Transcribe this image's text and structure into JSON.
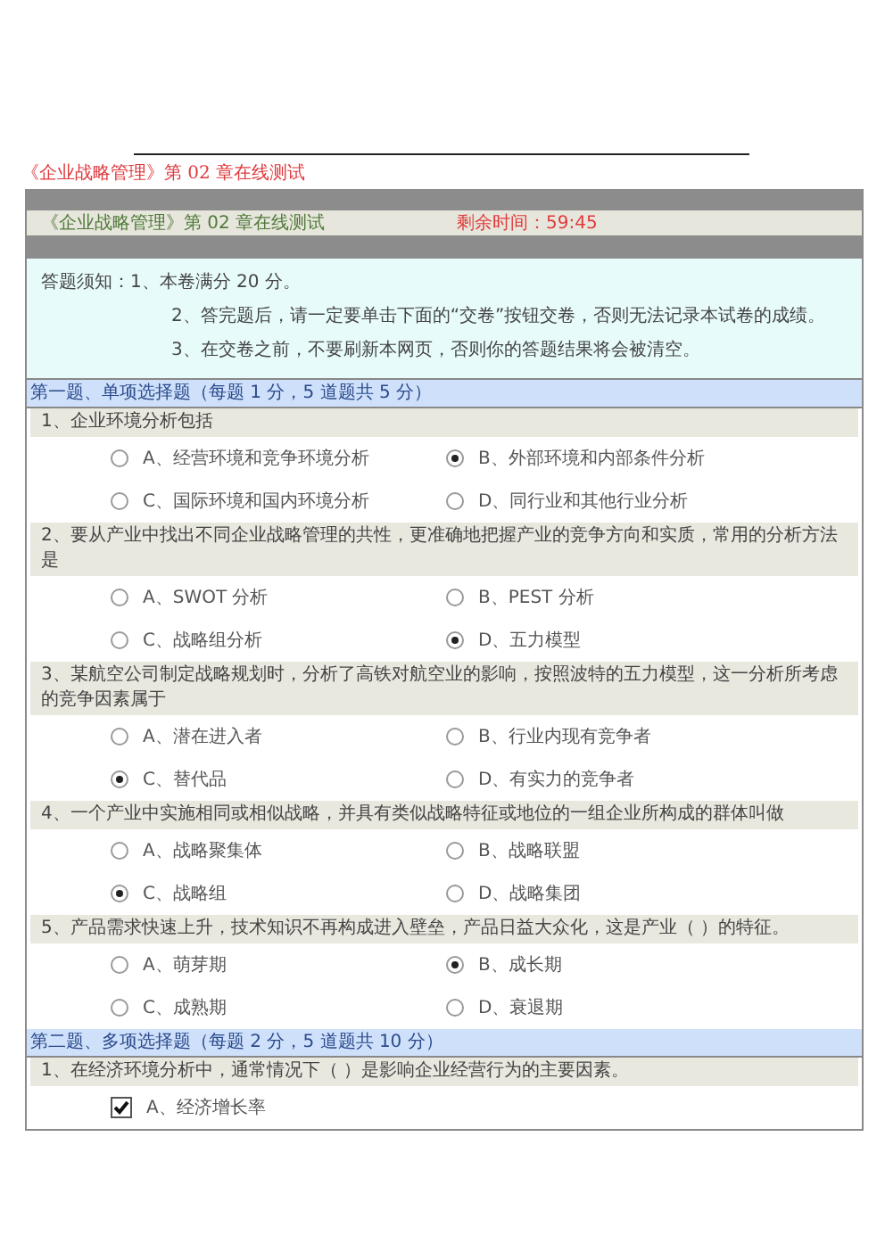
{
  "page_title": "《企业战略管理》第 02 章在线测试",
  "exam": {
    "title": "《企业战略管理》第 02 章在线测试",
    "timer": "剩余时间：59:45"
  },
  "notice": {
    "label": "答题须知：",
    "lines": [
      "1、本卷满分 20 分。",
      "2、答完题后，请一定要单击下面的“交卷”按钮交卷，否则无法记录本试卷的成绩。",
      "3、在交卷之前，不要刷新本网页，否则你的答题结果将会被清空。"
    ]
  },
  "sections": [
    {
      "title": "第一题、单项选择题（每题 1 分，5 道题共 5 分）",
      "kind": "single",
      "questions": [
        {
          "text": "1、企业环境分析包括",
          "options": [
            {
              "label": "A、经营环境和竞争环境分析",
              "selected": false
            },
            {
              "label": "B、外部环境和内部条件分析",
              "selected": true
            },
            {
              "label": "C、国际环境和国内环境分析",
              "selected": false
            },
            {
              "label": "D、同行业和其他行业分析",
              "selected": false
            }
          ]
        },
        {
          "text": "2、要从产业中找出不同企业战略管理的共性，更准确地把握产业的竞争方向和实质，常用的分析方法是",
          "options": [
            {
              "label": "A、SWOT 分析",
              "selected": false
            },
            {
              "label": "B、PEST 分析",
              "selected": false
            },
            {
              "label": "C、战略组分析",
              "selected": false
            },
            {
              "label": "D、五力模型",
              "selected": true
            }
          ]
        },
        {
          "text": "3、某航空公司制定战略规划时，分析了高铁对航空业的影响，按照波特的五力模型，这一分析所考虑的竞争因素属于",
          "options": [
            {
              "label": "A、潜在进入者",
              "selected": false
            },
            {
              "label": "B、行业内现有竞争者",
              "selected": false
            },
            {
              "label": "C、替代品",
              "selected": true
            },
            {
              "label": "D、有实力的竞争者",
              "selected": false
            }
          ]
        },
        {
          "text": "4、一个产业中实施相同或相似战略，并具有类似战略特征或地位的一组企业所构成的群体叫做",
          "options": [
            {
              "label": "A、战略聚集体",
              "selected": false
            },
            {
              "label": "B、战略联盟",
              "selected": false
            },
            {
              "label": "C、战略组",
              "selected": true
            },
            {
              "label": "D、战略集团",
              "selected": false
            }
          ]
        },
        {
          "text": "5、产品需求快速上升，技术知识不再构成进入壁垒，产品日益大众化，这是产业（ ）的特征。",
          "options": [
            {
              "label": "A、萌芽期",
              "selected": false
            },
            {
              "label": "B、成长期",
              "selected": true
            },
            {
              "label": "C、成熟期",
              "selected": false
            },
            {
              "label": "D、衰退期",
              "selected": false
            }
          ]
        }
      ]
    },
    {
      "title": "第二题、多项选择题（每题 2 分，5 道题共 10 分）",
      "kind": "multiple",
      "questions": [
        {
          "text": "1、在经济环境分析中，通常情况下（ ）是影响企业经营行为的主要因素。",
          "options": [
            {
              "label": "A、经济增长率",
              "selected": true
            }
          ]
        }
      ]
    }
  ]
}
